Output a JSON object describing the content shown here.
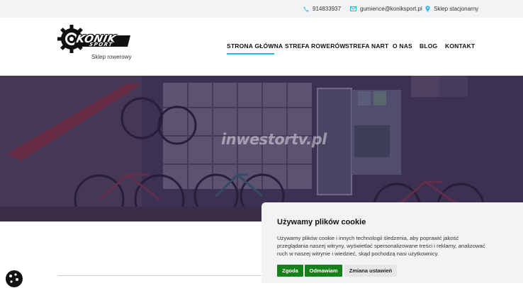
{
  "topbar": {
    "phone": "914833937",
    "email": "gumience@koniksport.pl",
    "store": "Sklep stacjonarny"
  },
  "header": {
    "logo_main": "KONIK",
    "logo_sub": "SPORT",
    "tagline": "Sklep rowerowy"
  },
  "nav": {
    "items": [
      "STRONA GŁÓWNA",
      "STREFA ROWERÓW",
      "STREFA NART",
      "O NAS",
      "BLOG",
      "KONTAKT"
    ],
    "active": "STRONA GŁÓWNA"
  },
  "hero": {
    "watermark": "inwestortv.pl"
  },
  "cookie": {
    "title": "Używamy plików cookie",
    "line1": "Używamy plików cookie i innych technologii śledzenia, aby poprawić jakość",
    "line2": "przeglądania naszej witryny, wyświetlać spersonalizowane treści i reklamy, analizować",
    "line3": "ruch w naszej witrynie i wiedzieć, skąd pochodzą nasi użytkownicy.",
    "accept": "Zgoda",
    "reject": "Odmawiam",
    "settings": "Zmiana ustawień"
  },
  "colors": {
    "accent": "#29b6e8",
    "button_green": "#16801a",
    "topbar_bg": "#f1f3f4"
  }
}
